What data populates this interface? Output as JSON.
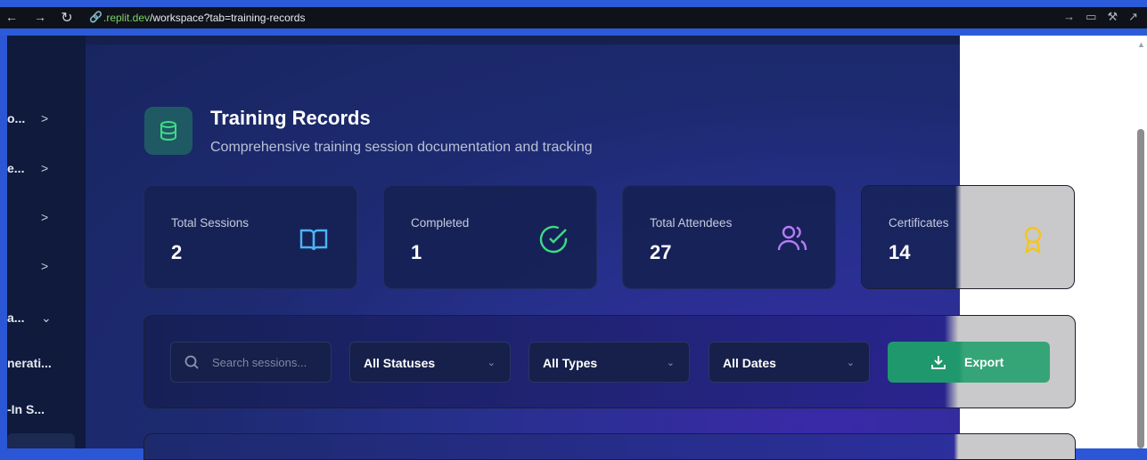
{
  "browser": {
    "url_host": ".replit.dev",
    "url_path": "/workspace?tab=training-records"
  },
  "sidebar": {
    "items": [
      {
        "label": "o...",
        "chevron": ">"
      },
      {
        "label": "e...",
        "chevron": ">"
      },
      {
        "label": "",
        "chevron": ">"
      },
      {
        "label": "",
        "chevron": ">"
      },
      {
        "label": "a...",
        "chevron": "⌄"
      },
      {
        "label": "nerati...",
        "chevron": ""
      },
      {
        "label": "-In S...",
        "chevron": ""
      }
    ]
  },
  "header": {
    "title": "Training Records",
    "subtitle": "Comprehensive training session documentation and tracking",
    "icon": "database-icon"
  },
  "stats": [
    {
      "label": "Total Sessions",
      "value": "2",
      "icon": "book-icon",
      "color": "#4db3f5"
    },
    {
      "label": "Completed",
      "value": "1",
      "icon": "check-circle-icon",
      "color": "#3ddc84"
    },
    {
      "label": "Total Attendees",
      "value": "27",
      "icon": "users-icon",
      "color": "#b47cf5"
    },
    {
      "label": "Certificates",
      "value": "14",
      "icon": "award-icon",
      "color": "#f5c518"
    }
  ],
  "filters": {
    "search_placeholder": "Search sessions...",
    "status": "All Statuses",
    "type": "All Types",
    "dates": "All Dates",
    "export_label": "Export"
  },
  "colors": {
    "accent_green": "#20986d",
    "browser_blue": "#2b5bd8"
  }
}
